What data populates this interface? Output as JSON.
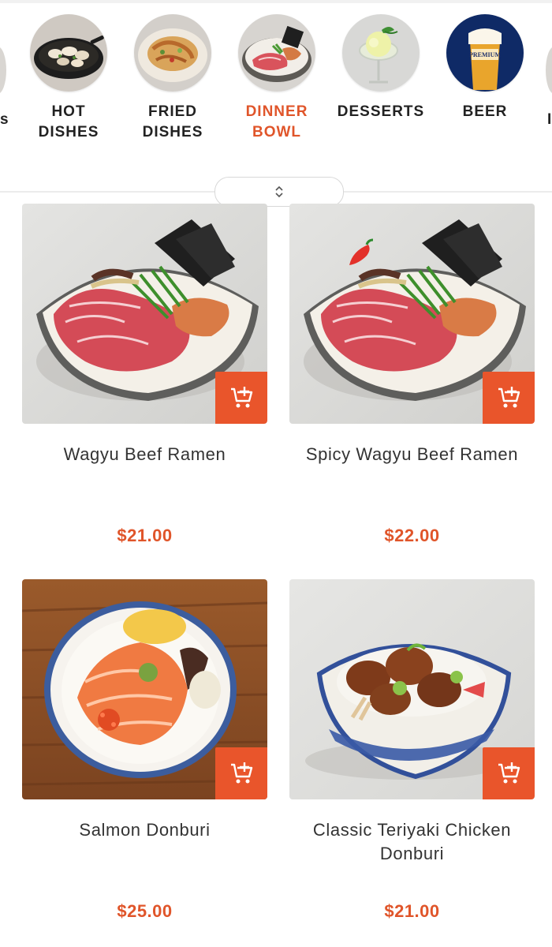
{
  "categories": [
    {
      "label": "HOT\nDISHES",
      "active": false,
      "icon": "clams-pan-icon"
    },
    {
      "label": "FRIED\nDISHES",
      "active": false,
      "icon": "fried-dish-icon"
    },
    {
      "label": "DINNER\nBOWL",
      "active": true,
      "icon": "beef-bowl-icon"
    },
    {
      "label": "DESSERTS",
      "active": false,
      "icon": "dessert-glass-icon"
    },
    {
      "label": "BEER",
      "active": false,
      "icon": "premium-beer-icon"
    }
  ],
  "beer_brand": "PREMIUM",
  "colors": {
    "accent": "#e0552a",
    "cart_bg": "#e9552b",
    "text": "#333333"
  },
  "products": [
    {
      "name": "Wagyu Beef Ramen",
      "price": "$21.00",
      "icon": "wagyu-ramen-photo"
    },
    {
      "name": "Spicy Wagyu Beef Ramen",
      "price": "$22.00",
      "icon": "spicy-wagyu-ramen-photo",
      "spicy": true
    },
    {
      "name": "Salmon Donburi",
      "price": "$25.00",
      "icon": "salmon-donburi-photo"
    },
    {
      "name": "Classic Teriyaki Chicken Donburi",
      "price": "$21.00",
      "icon": "teriyaki-chicken-photo"
    }
  ]
}
